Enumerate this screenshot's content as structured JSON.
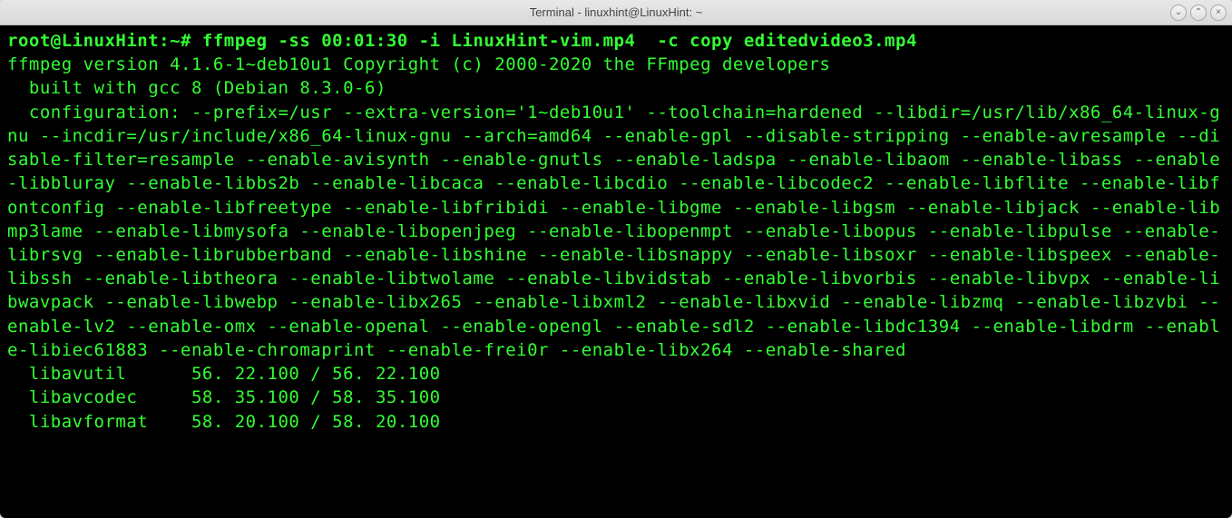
{
  "window": {
    "title": "Terminal - linuxhint@LinuxHint: ~"
  },
  "terminal": {
    "prompt": "root@LinuxHint:~# ",
    "command": "ffmpeg -ss 00:01:30 -i LinuxHint-vim.mp4  -c copy editedvideo3.mp4",
    "output": "ffmpeg version 4.1.6-1~deb10u1 Copyright (c) 2000-2020 the FFmpeg developers\n  built with gcc 8 (Debian 8.3.0-6)\n  configuration: --prefix=/usr --extra-version='1~deb10u1' --toolchain=hardened --libdir=/usr/lib/x86_64-linux-gnu --incdir=/usr/include/x86_64-linux-gnu --arch=amd64 --enable-gpl --disable-stripping --enable-avresample --disable-filter=resample --enable-avisynth --enable-gnutls --enable-ladspa --enable-libaom --enable-libass --enable-libbluray --enable-libbs2b --enable-libcaca --enable-libcdio --enable-libcodec2 --enable-libflite --enable-libfontconfig --enable-libfreetype --enable-libfribidi --enable-libgme --enable-libgsm --enable-libjack --enable-libmp3lame --enable-libmysofa --enable-libopenjpeg --enable-libopenmpt --enable-libopus --enable-libpulse --enable-librsvg --enable-librubberband --enable-libshine --enable-libsnappy --enable-libsoxr --enable-libspeex --enable-libssh --enable-libtheora --enable-libtwolame --enable-libvidstab --enable-libvorbis --enable-libvpx --enable-libwavpack --enable-libwebp --enable-libx265 --enable-libxml2 --enable-libxvid --enable-libzmq --enable-libzvbi --enable-lv2 --enable-omx --enable-openal --enable-opengl --enable-sdl2 --enable-libdc1394 --enable-libdrm --enable-libiec61883 --enable-chromaprint --enable-frei0r --enable-libx264 --enable-shared\n  libavutil      56. 22.100 / 56. 22.100\n  libavcodec     58. 35.100 / 58. 35.100\n  libavformat    58. 20.100 / 58. 20.100"
  },
  "buttons": {
    "minimize": "⌄",
    "maximize": "⌃",
    "close": "×"
  }
}
